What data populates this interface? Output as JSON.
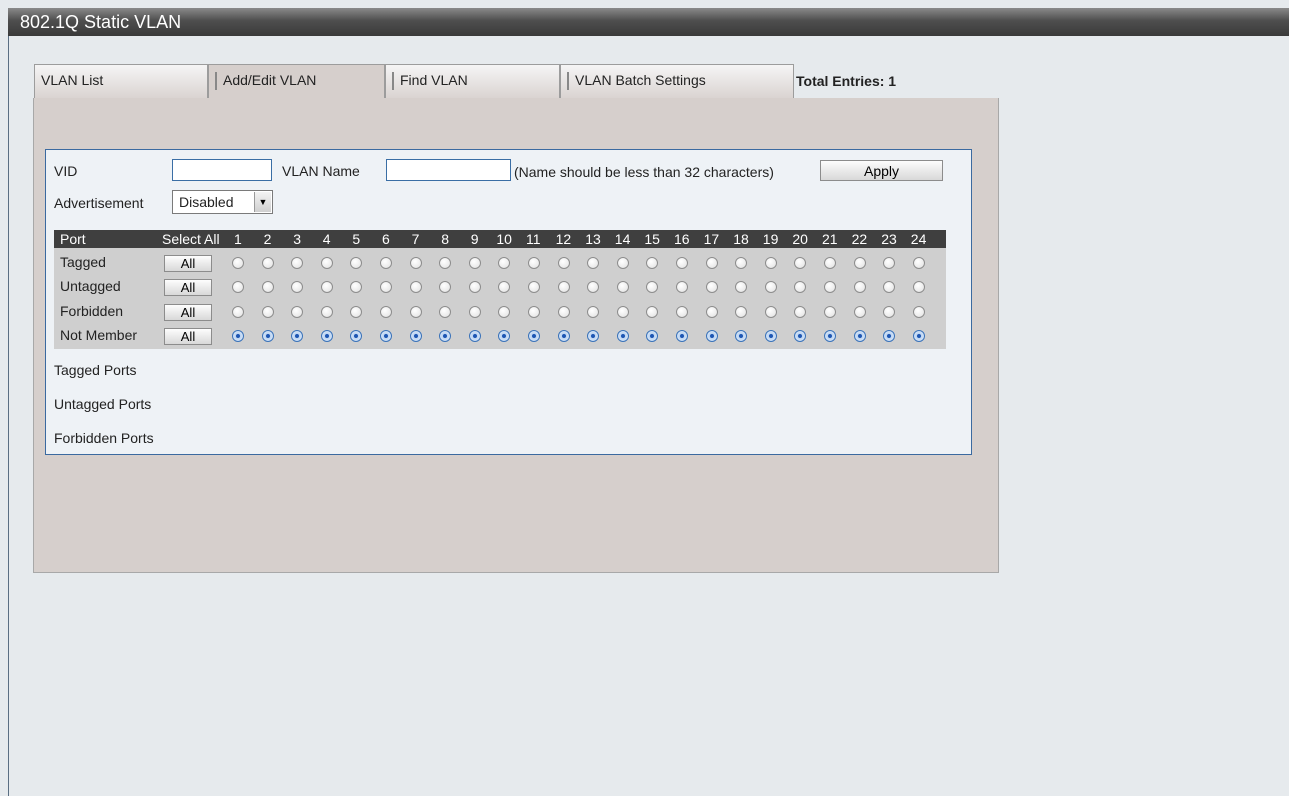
{
  "title": "802.1Q Static VLAN",
  "tabs": [
    {
      "label": "VLAN List",
      "active": false
    },
    {
      "label": "Add/Edit VLAN",
      "active": true
    },
    {
      "label": "Find VLAN",
      "active": false
    },
    {
      "label": "VLAN Batch Settings",
      "active": false
    }
  ],
  "total_entries": "Total Entries: 1",
  "form": {
    "vid_label": "VID",
    "vid_value": "",
    "vlan_name_label": "VLAN Name",
    "vlan_name_value": "",
    "name_hint": "(Name should be less than 32 characters)",
    "apply_label": "Apply",
    "advertisement_label": "Advertisement",
    "advertisement_value": "Disabled"
  },
  "grid": {
    "port_header": "Port",
    "select_all_header": "Select All",
    "ports": [
      "1",
      "2",
      "3",
      "4",
      "5",
      "6",
      "7",
      "8",
      "9",
      "10",
      "11",
      "12",
      "13",
      "14",
      "15",
      "16",
      "17",
      "18",
      "19",
      "20",
      "21",
      "22",
      "23",
      "24"
    ],
    "rows": [
      {
        "label": "Tagged",
        "button": "All",
        "checked": false
      },
      {
        "label": "Untagged",
        "button": "All",
        "checked": false
      },
      {
        "label": "Forbidden",
        "button": "All",
        "checked": false
      },
      {
        "label": "Not Member",
        "button": "All",
        "checked": true
      }
    ]
  },
  "ports_summary": {
    "tagged": "Tagged Ports",
    "untagged": "Untagged Ports",
    "forbidden": "Forbidden Ports"
  },
  "colors": {
    "title_bar": "#4e4e4e",
    "panel": "#d6cfcc",
    "form_border": "#3b6aa0",
    "grid_header": "#3f3f3f",
    "radio_selected": "#1d56b3"
  }
}
